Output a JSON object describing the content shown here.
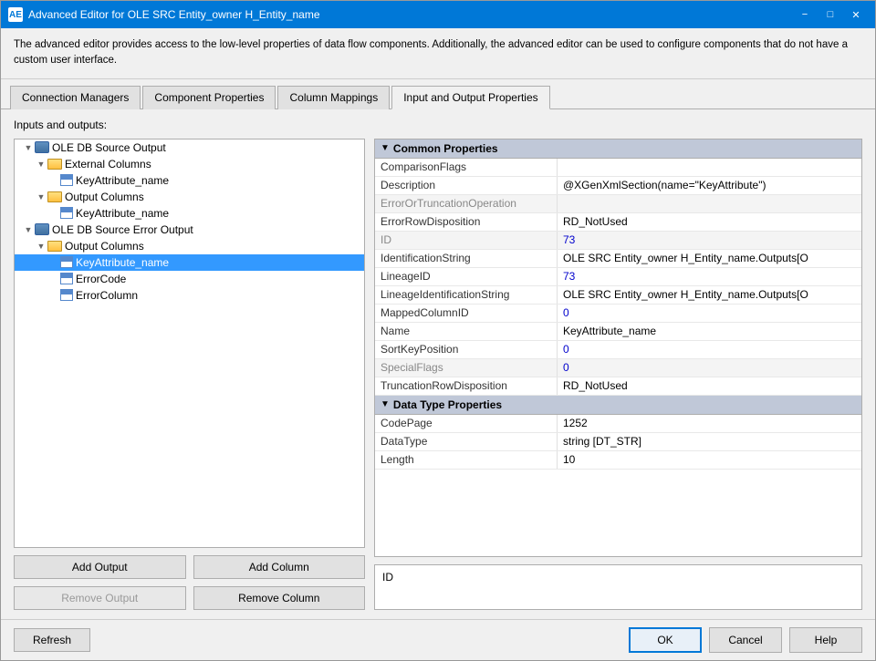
{
  "window": {
    "title": "Advanced Editor for OLE SRC Entity_owner H_Entity_name",
    "icon": "AE"
  },
  "info": {
    "text": "The advanced editor provides access to the low-level properties of data flow components. Additionally, the advanced editor can be used to configure components that do not have a custom user interface."
  },
  "tabs": [
    {
      "label": "Connection Managers",
      "active": false
    },
    {
      "label": "Component Properties",
      "active": false
    },
    {
      "label": "Column Mappings",
      "active": false
    },
    {
      "label": "Input and Output Properties",
      "active": true
    }
  ],
  "section_label": "Inputs and outputs:",
  "tree": {
    "items": [
      {
        "level": 1,
        "label": "OLE DB Source Output",
        "icon": "db",
        "expanded": true,
        "expandable": true
      },
      {
        "level": 2,
        "label": "External Columns",
        "icon": "folder",
        "expanded": true,
        "expandable": true
      },
      {
        "level": 3,
        "label": "KeyAttribute_name",
        "icon": "col",
        "expandable": false
      },
      {
        "level": 2,
        "label": "Output Columns",
        "icon": "folder",
        "expanded": true,
        "expandable": true
      },
      {
        "level": 3,
        "label": "KeyAttribute_name",
        "icon": "col",
        "expandable": false
      },
      {
        "level": 1,
        "label": "OLE DB Source Error Output",
        "icon": "db",
        "expanded": true,
        "expandable": true
      },
      {
        "level": 2,
        "label": "Output Columns",
        "icon": "folder",
        "expanded": true,
        "expandable": true
      },
      {
        "level": 3,
        "label": "KeyAttribute_name",
        "icon": "col",
        "selected": true,
        "expandable": false
      },
      {
        "level": 3,
        "label": "ErrorCode",
        "icon": "col",
        "expandable": false
      },
      {
        "level": 3,
        "label": "ErrorColumn",
        "icon": "col",
        "expandable": false
      }
    ]
  },
  "buttons": {
    "add_output": "Add Output",
    "add_column": "Add Column",
    "remove_output": "Remove Output",
    "remove_column": "Remove Column"
  },
  "properties": {
    "sections": [
      {
        "name": "Common Properties",
        "expanded": true,
        "rows": [
          {
            "name": "ComparisonFlags",
            "value": "",
            "greyed": false
          },
          {
            "name": "Description",
            "value": "@XGenXmlSection(name=\"KeyAttribute\")",
            "greyed": false
          },
          {
            "name": "ErrorOrTruncationOperation",
            "value": "",
            "greyed": true
          },
          {
            "name": "ErrorRowDisposition",
            "value": "RD_NotUsed",
            "greyed": false
          },
          {
            "name": "ID",
            "value": "73",
            "greyed": true,
            "blue": true
          },
          {
            "name": "IdentificationString",
            "value": "OLE SRC Entity_owner H_Entity_name.Outputs[O",
            "greyed": false
          },
          {
            "name": "LineageID",
            "value": "73",
            "greyed": false,
            "blue": true
          },
          {
            "name": "LineageIdentificationString",
            "value": "OLE SRC Entity_owner H_Entity_name.Outputs[O",
            "greyed": false
          },
          {
            "name": "MappedColumnID",
            "value": "0",
            "greyed": false,
            "blue": true
          },
          {
            "name": "Name",
            "value": "KeyAttribute_name",
            "greyed": false
          },
          {
            "name": "SortKeyPosition",
            "value": "0",
            "greyed": false,
            "blue": true
          },
          {
            "name": "SpecialFlags",
            "value": "0",
            "greyed": true,
            "blue": true
          },
          {
            "name": "TruncationRowDisposition",
            "value": "RD_NotUsed",
            "greyed": false
          }
        ]
      },
      {
        "name": "Data Type Properties",
        "expanded": true,
        "rows": [
          {
            "name": "CodePage",
            "value": "1252",
            "greyed": false
          },
          {
            "name": "DataType",
            "value": "string [DT_STR]",
            "greyed": false
          },
          {
            "name": "Length",
            "value": "10",
            "greyed": false
          }
        ]
      }
    ]
  },
  "id_box": {
    "label": "ID"
  },
  "footer": {
    "refresh": "Refresh",
    "ok": "OK",
    "cancel": "Cancel",
    "help": "Help"
  }
}
